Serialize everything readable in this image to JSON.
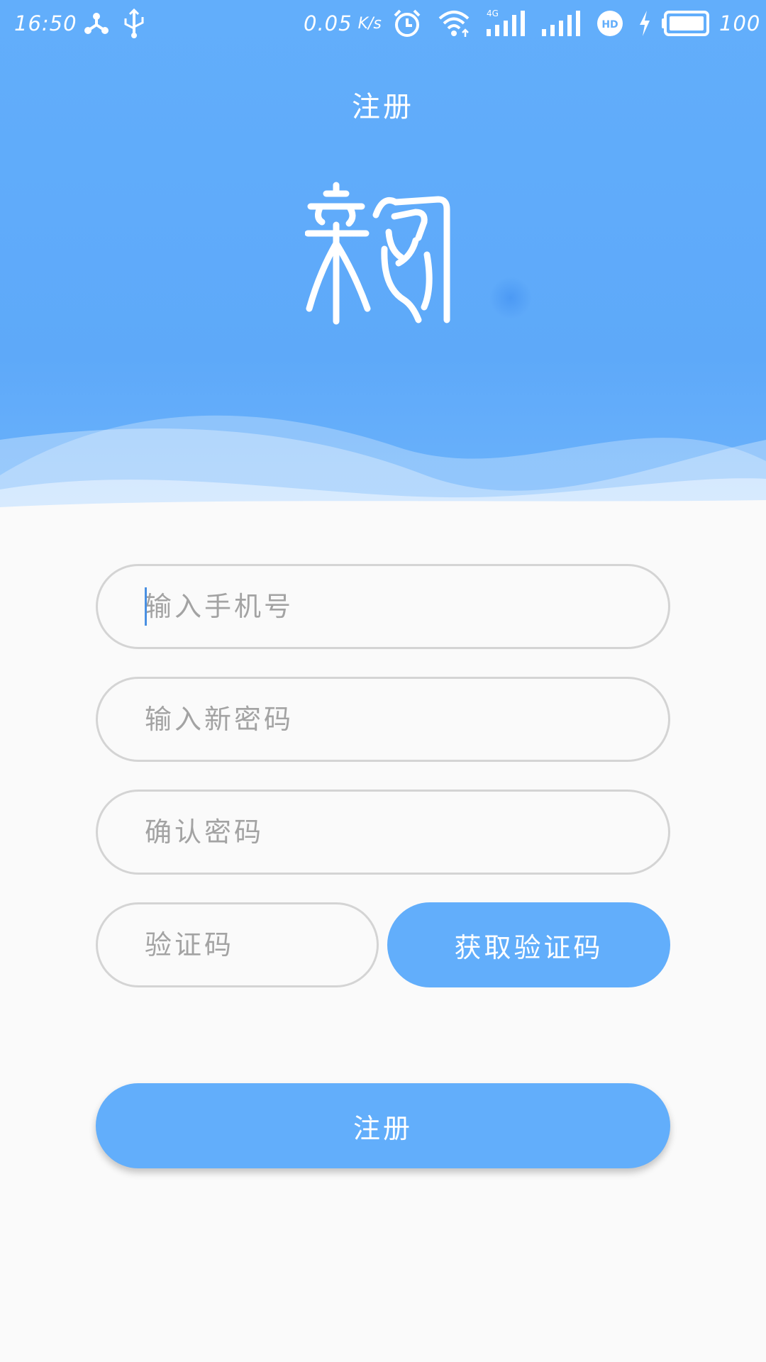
{
  "status_bar": {
    "time": "16:50",
    "net_speed": "0.05",
    "net_unit": "K/s",
    "battery_level": "100",
    "icons": [
      "share-icon",
      "usb-icon",
      "alarm-icon",
      "wifi-icon",
      "signal-4g-icon",
      "signal-icon",
      "hd-icon",
      "charging-icon",
      "battery-icon"
    ]
  },
  "header": {
    "title": "注册",
    "logo_name": "app-logo"
  },
  "form": {
    "phone": {
      "placeholder": "输入手机号",
      "value": ""
    },
    "new_password": {
      "placeholder": "输入新密码",
      "value": ""
    },
    "confirm_password": {
      "placeholder": "确认密码",
      "value": ""
    },
    "code": {
      "placeholder": "验证码",
      "value": ""
    },
    "get_code_label": "获取验证码",
    "submit_label": "注册"
  },
  "colors": {
    "primary": "#62aefb",
    "background": "#fafafa",
    "field_border": "#d4d4d4",
    "placeholder": "#a3a3a3"
  }
}
